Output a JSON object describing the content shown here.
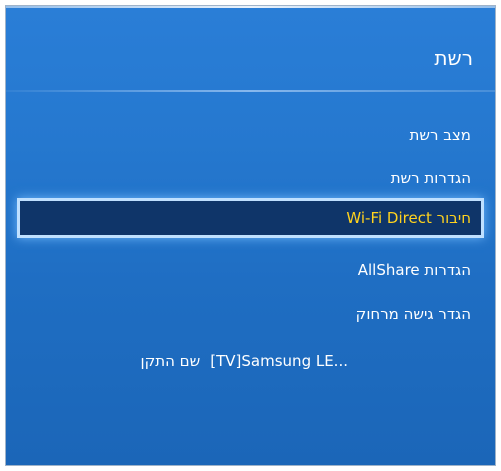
{
  "menu": {
    "title": "רשת",
    "items": [
      {
        "label": "מצב רשת",
        "selected": false
      },
      {
        "label": "הגדרות רשת",
        "selected": false
      },
      {
        "label": "חיבור Wi-Fi Direct",
        "selected": true
      },
      {
        "label": "הגדרות AllShare",
        "selected": false
      },
      {
        "label": "הגדר גישה מרחוק",
        "selected": false
      }
    ],
    "device_name_label": "שם התקן",
    "device_name_value": "[TV]Samsung LE..."
  },
  "colors": {
    "background": "#2272c9",
    "highlight_bg": "#0f3569",
    "highlight_text": "#ffd21e",
    "text": "#ffffff"
  }
}
